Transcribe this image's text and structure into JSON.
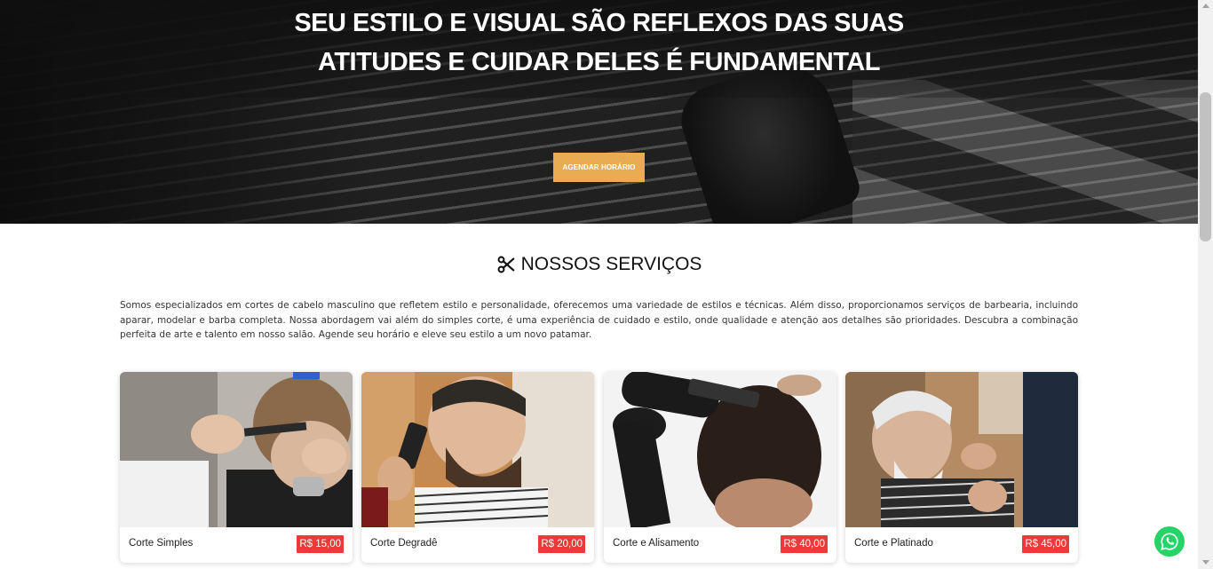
{
  "hero": {
    "title_line1": "SEU ESTILO E VISUAL SÃO REFLEXOS DAS SUAS",
    "title_line2": "ATITUDES E CUIDAR DELES É FUNDAMENTAL",
    "cta_label": "AGENDAR HORÁRIO",
    "cta_color": "#e9ac52"
  },
  "services": {
    "icon": "scissors-icon",
    "title": "NOSSOS SERVIÇOS",
    "description": "Somos especializados em cortes de cabelo masculino que refletem estilo e personalidade, oferecemos uma variedade de estilos e técnicas. Além disso, proporcionamos serviços de barbearia, incluindo aparar, modelar e barba completa. Nossa abordagem vai além do simples corte, é uma experiência de cuidado e estilo, onde qualidade e atenção aos detalhes são prioridades. Descubra a combinação perfeita de arte e talento em nosso salão. Agende seu horário e eleve seu estilo a um novo patamar.",
    "cards": [
      {
        "name": "Corte Simples",
        "price": "R$ 15,00"
      },
      {
        "name": "Corte Degradê",
        "price": "R$ 20,00"
      },
      {
        "name": "Corte e Alisamento",
        "price": "R$ 40,00"
      },
      {
        "name": "Corte e Platinado",
        "price": "R$ 45,00"
      }
    ],
    "price_color": "#ec3a3a"
  },
  "floating": {
    "icon": "whatsapp-icon",
    "color": "#25d366"
  }
}
